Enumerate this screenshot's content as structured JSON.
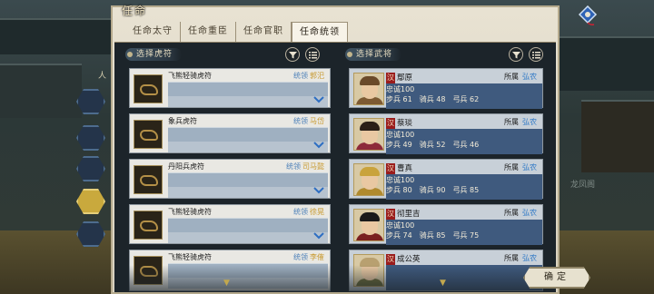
{
  "title": "任命",
  "tabs": [
    "任命太守",
    "任命重臣",
    "任命官职",
    "任命统领"
  ],
  "active_tab": 3,
  "side_label": "人",
  "right_bg_label": "龙凤阁",
  "left_panel": {
    "title": "选择虎符",
    "owner_prefix": "统领",
    "cards": [
      {
        "name": "飞熊轻骑虎符",
        "owner": "郭汜"
      },
      {
        "name": "象兵虎符",
        "owner": "马岱"
      },
      {
        "name": "丹阳兵虎符",
        "owner": "司马懿"
      },
      {
        "name": "飞熊轻骑虎符",
        "owner": "徐晃"
      },
      {
        "name": "飞熊轻骑虎符",
        "owner": "李傕"
      }
    ]
  },
  "right_panel": {
    "title": "选择武将",
    "faction_badge": "汉",
    "owner_prefix": "所属",
    "stat_labels": {
      "loyalty": "忠诚",
      "infantry": "步兵",
      "cavalry": "骑兵",
      "archer": "弓兵"
    },
    "generals": [
      {
        "name": "鄢原",
        "owner": "弘农",
        "loyalty": 100,
        "infantry": 61,
        "cavalry": 48,
        "archer": 62
      },
      {
        "name": "蔡琰",
        "owner": "弘农",
        "loyalty": 100,
        "infantry": 49,
        "cavalry": 52,
        "archer": 46
      },
      {
        "name": "曹真",
        "owner": "弘农",
        "loyalty": 100,
        "infantry": 80,
        "cavalry": 90,
        "archer": 85
      },
      {
        "name": "彻里吉",
        "owner": "弘农",
        "loyalty": 100,
        "infantry": 74,
        "cavalry": 85,
        "archer": 75
      },
      {
        "name": "成公英",
        "owner": "弘农",
        "loyalty": "",
        "infantry": "",
        "cavalry": "",
        "archer": ""
      }
    ]
  },
  "confirm_label": "确定",
  "icons": {
    "filter": "funnel-icon",
    "list": "list-icon",
    "expand": "chevron-down-icon",
    "kite": "kite-icon"
  },
  "colors": {
    "faction": "#9a1c1c",
    "owner_link": "#2e78c6",
    "commander_name": "#c89a30"
  }
}
